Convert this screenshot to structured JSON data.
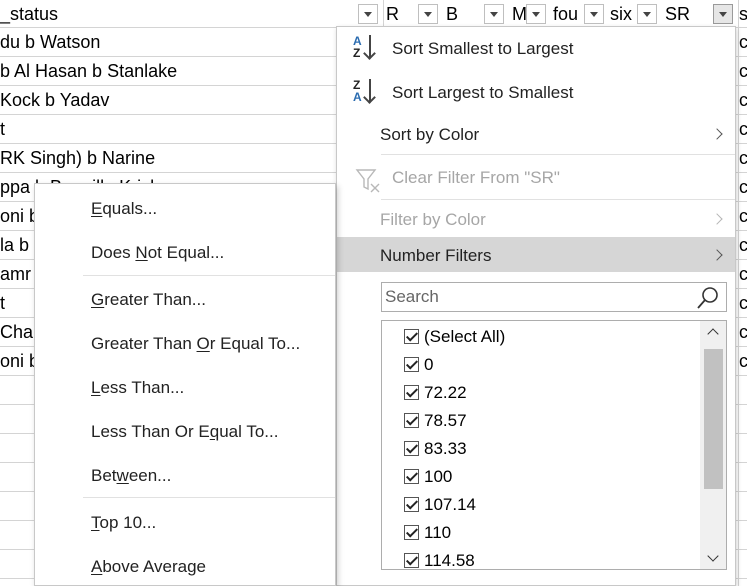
{
  "header": {
    "status_col": "_status",
    "columns": [
      "R",
      "B",
      "M",
      "fou",
      "six",
      "SR"
    ]
  },
  "rows": [
    "du b Watson",
    "b Al Hasan b Stanlake",
    "Kock b Yadav",
    "t",
    "RK Singh) b Narine",
    "ppa b Bangilla Krish",
    "oni b",
    "la b",
    "amr",
    "t",
    "Chak",
    "oni b"
  ],
  "right_col_values": [
    "s",
    "c",
    "c",
    "c",
    "c",
    "c",
    "c",
    "c",
    "c",
    "c",
    "c",
    "c",
    "c"
  ],
  "filter_menu": {
    "sort_asc": "Sort Smallest to Largest",
    "sort_desc": "Sort Largest to Smallest",
    "sort_by_color": "Sort by Color",
    "clear_filter": "Clear Filter From \"SR\"",
    "filter_by_color": "Filter by Color",
    "number_filters": "Number Filters",
    "search_placeholder": "Search",
    "values": [
      "(Select All)",
      "0",
      "72.22",
      "78.57",
      "83.33",
      "100",
      "107.14",
      "110",
      "114.58"
    ]
  },
  "number_filters_submenu": {
    "items": [
      "Equals...",
      "Does Not Equal...",
      "Greater Than...",
      "Greater Than Or Equal To...",
      "Less Than...",
      "Less Than Or Equal To...",
      "Between...",
      "Top 10...",
      "Above Average"
    ]
  },
  "colors": {
    "hover": "#d6d6d6",
    "disabled": "#a6a6a6",
    "border": "#c8c8c8"
  }
}
